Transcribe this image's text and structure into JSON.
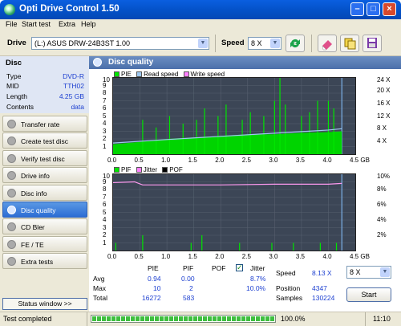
{
  "window": {
    "title": "Opti Drive Control 1.50"
  },
  "menu": [
    "File",
    "Start test",
    "Extra",
    "Help"
  ],
  "toolbar": {
    "drive_label": "Drive",
    "drive_value": "(L:)  ASUS DRW-24B3ST 1.00",
    "speed_label": "Speed",
    "speed_value": "8 X"
  },
  "disc": {
    "heading": "Disc",
    "rows": [
      {
        "label": "Type",
        "value": "DVD-R"
      },
      {
        "label": "MID",
        "value": "TTH02"
      },
      {
        "label": "Length",
        "value": "4.25 GB"
      },
      {
        "label": "Contents",
        "value": "data"
      }
    ]
  },
  "nav": [
    {
      "label": "Transfer rate",
      "active": false
    },
    {
      "label": "Create test disc",
      "active": false
    },
    {
      "label": "Verify test disc",
      "active": false
    },
    {
      "label": "Drive info",
      "active": false
    },
    {
      "label": "Disc info",
      "active": false
    },
    {
      "label": "Disc quality",
      "active": true
    },
    {
      "label": "CD Bler",
      "active": false
    },
    {
      "label": "FE / TE",
      "active": false
    },
    {
      "label": "Extra tests",
      "active": false
    }
  ],
  "status_window_label": "Status window >>",
  "section_title": "Disc quality",
  "chart_data": [
    {
      "type": "area",
      "legend": [
        "PIE",
        "Read speed",
        "Write speed"
      ],
      "colors": {
        "PIE": "#00e600",
        "Read speed": "#9ec8f0",
        "Write speed": "#ff80ff"
      },
      "x_ticks": [
        "0.0",
        "0.5",
        "1.0",
        "1.5",
        "2.0",
        "2.5",
        "3.0",
        "3.5",
        "4.0",
        "4.5 GB"
      ],
      "y_ticks_left": [
        "10",
        "9",
        "8",
        "7",
        "6",
        "5",
        "4",
        "3",
        "2",
        "1"
      ],
      "y_ticks_right": [
        "24 X",
        "20 X",
        "16 X",
        "12 X",
        "8 X",
        "4 X"
      ],
      "xlim": [
        0,
        4.5
      ],
      "ylim": [
        0,
        10
      ],
      "y2lim": [
        0,
        24
      ],
      "pie_base": [
        [
          0,
          1.3
        ],
        [
          0.5,
          1.6
        ],
        [
          1.0,
          2.0
        ],
        [
          1.5,
          2.2
        ],
        [
          2.0,
          2.4
        ],
        [
          2.5,
          2.6
        ],
        [
          3.0,
          2.6
        ],
        [
          3.5,
          2.8
        ],
        [
          4.0,
          2.9
        ],
        [
          4.25,
          3.0
        ]
      ],
      "pie_spikes": [
        [
          0.55,
          4.5
        ],
        [
          0.8,
          3.5
        ],
        [
          1.05,
          5
        ],
        [
          1.3,
          4
        ],
        [
          1.55,
          4.5
        ],
        [
          1.7,
          6
        ],
        [
          1.95,
          5
        ],
        [
          2.1,
          6.5
        ],
        [
          2.4,
          4.5
        ],
        [
          2.55,
          5.5
        ],
        [
          2.8,
          5
        ],
        [
          3.0,
          7
        ],
        [
          3.1,
          10
        ],
        [
          3.2,
          6.5
        ],
        [
          3.5,
          5
        ],
        [
          3.65,
          5.5
        ],
        [
          3.8,
          7
        ],
        [
          4.0,
          7
        ],
        [
          4.1,
          6
        ]
      ],
      "read_speed": [
        [
          0,
          3.5
        ],
        [
          1.0,
          4.6
        ],
        [
          2.0,
          5.6
        ],
        [
          3.0,
          6.6
        ],
        [
          4.0,
          7.6
        ],
        [
          4.25,
          8.0
        ]
      ]
    },
    {
      "type": "area",
      "legend": [
        "PIF",
        "Jitter",
        "POF"
      ],
      "colors": {
        "PIF": "#00e600",
        "Jitter": "#ff80ff",
        "POF": "#000000"
      },
      "x_ticks": [
        "0.0",
        "0.5",
        "1.0",
        "1.5",
        "2.0",
        "2.5",
        "3.0",
        "3.5",
        "4.0",
        "4.5 GB"
      ],
      "y_ticks_left": [
        "10",
        "9",
        "8",
        "7",
        "6",
        "5",
        "4",
        "3",
        "2",
        "1"
      ],
      "y_ticks_right": [
        "10%",
        "8%",
        "6%",
        "4%",
        "2%"
      ],
      "xlim": [
        0,
        4.5
      ],
      "ylim": [
        0,
        10
      ],
      "y2lim": [
        0,
        10
      ],
      "pif_spikes": [
        [
          0.05,
          1
        ],
        [
          0.55,
          2
        ],
        [
          1.45,
          1
        ],
        [
          1.65,
          2
        ],
        [
          2.35,
          1
        ],
        [
          2.95,
          1
        ],
        [
          3.35,
          1
        ],
        [
          3.85,
          1
        ],
        [
          4.15,
          1
        ]
      ],
      "jitter": [
        [
          0,
          8.9
        ],
        [
          0.4,
          9.0
        ],
        [
          0.55,
          8.6
        ],
        [
          1.0,
          8.6
        ],
        [
          2.0,
          8.6
        ],
        [
          3.0,
          8.7
        ],
        [
          4.0,
          8.7
        ],
        [
          4.25,
          8.8
        ]
      ]
    }
  ],
  "stats": {
    "headers": {
      "pie": "PIE",
      "pif": "PIF",
      "pof": "POF",
      "jitter": "Jitter"
    },
    "rows": [
      {
        "label": "Avg",
        "pie": "0.94",
        "pif": "0.00",
        "jitter": "8.7%"
      },
      {
        "label": "Max",
        "pie": "10",
        "pif": "2",
        "jitter": "10.0%"
      },
      {
        "label": "Total",
        "pie": "16272",
        "pif": "583",
        "jitter": ""
      }
    ],
    "speed_label": "Speed",
    "speed_value": "8.13 X",
    "position_label": "Position",
    "position_value": "4347",
    "samples_label": "Samples",
    "samples_value": "130224",
    "speed_select": "8 X",
    "start_label": "Start"
  },
  "statusbar": {
    "text": "Test completed",
    "progress_value": 100,
    "progress_text": "100.0%",
    "time": "11:10"
  }
}
